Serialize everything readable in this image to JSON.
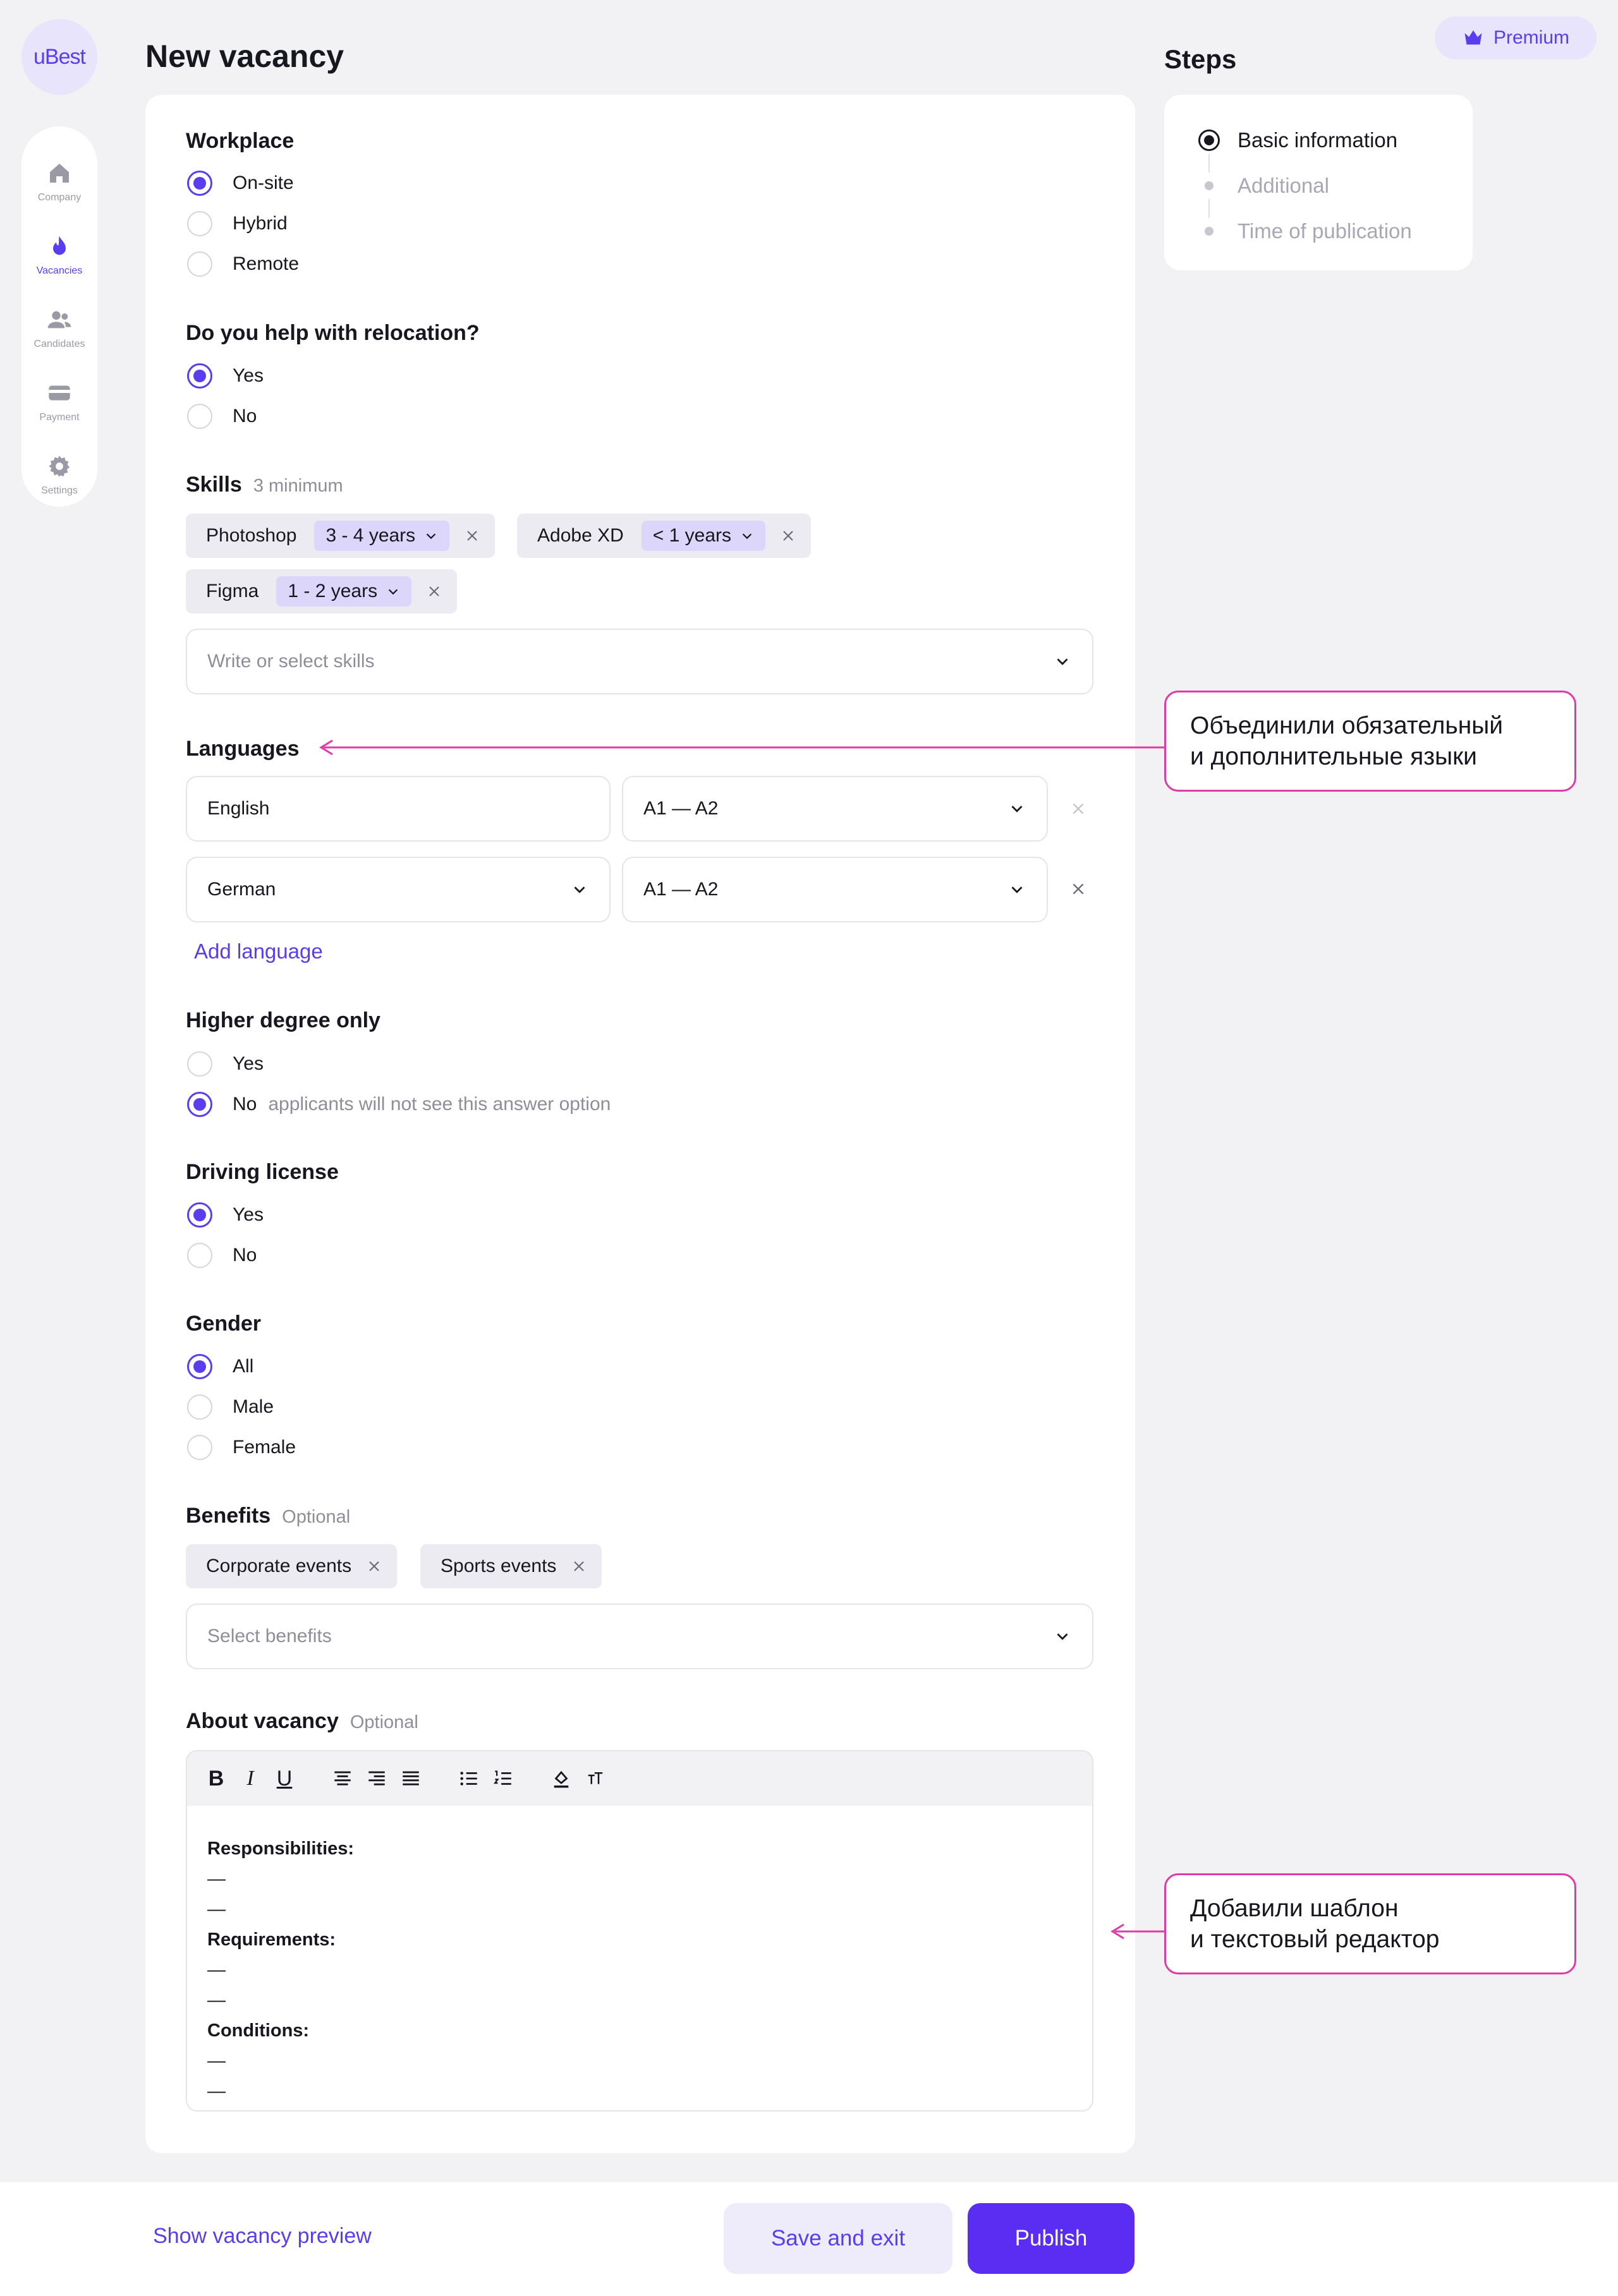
{
  "app": {
    "logo": "uBest",
    "premium_label": "Premium"
  },
  "nav": {
    "items": [
      {
        "label": "Company",
        "icon": "home-icon"
      },
      {
        "label": "Vacancies",
        "icon": "flame-icon"
      },
      {
        "label": "Candidates",
        "icon": "users-icon"
      },
      {
        "label": "Payment",
        "icon": "card-icon"
      },
      {
        "label": "Settings",
        "icon": "gear-icon"
      }
    ],
    "active": "Vacancies"
  },
  "page": {
    "title": "New vacancy"
  },
  "steps": {
    "title": "Steps",
    "items": [
      "Basic information",
      "Additional",
      "Time of publication"
    ],
    "current": "Basic information"
  },
  "form": {
    "workplace": {
      "label": "Workplace",
      "options": [
        "On-site",
        "Hybrid",
        "Remote"
      ],
      "selected": "On-site"
    },
    "relocation": {
      "label": "Do you help with relocation?",
      "options": [
        "Yes",
        "No"
      ],
      "selected": "Yes"
    },
    "skills": {
      "label": "Skills",
      "hint": "3 minimum",
      "chips": [
        {
          "name": "Photoshop",
          "years": "3 - 4 years"
        },
        {
          "name": "Adobe XD",
          "years": "< 1 years"
        },
        {
          "name": "Figma",
          "years": "1 - 2 years"
        }
      ],
      "placeholder": "Write or select skills"
    },
    "languages": {
      "label": "Languages",
      "rows": [
        {
          "language": "English",
          "level": "A1 — A2"
        },
        {
          "language": "German",
          "level": "A1 — A2"
        }
      ],
      "add_label": "Add language"
    },
    "higher_degree": {
      "label": "Higher degree only",
      "options": [
        "Yes",
        "No"
      ],
      "selected": "No",
      "no_hint": "applicants will not see this answer option"
    },
    "driving": {
      "label": "Driving license",
      "options": [
        "Yes",
        "No"
      ],
      "selected": "Yes"
    },
    "gender": {
      "label": "Gender",
      "options": [
        "All",
        "Male",
        "Female"
      ],
      "selected": "All"
    },
    "benefits": {
      "label": "Benefits",
      "hint": "Optional",
      "chips": [
        "Corporate events",
        "Sports events"
      ],
      "placeholder": "Select benefits"
    },
    "about": {
      "label": "About vacancy",
      "hint": "Optional",
      "toolbar": [
        "B",
        "I",
        "U"
      ],
      "body": {
        "responsibilities": "Responsibilities:",
        "requirements": "Requirements:",
        "conditions": "Conditions:",
        "dash": "—"
      }
    }
  },
  "callouts": {
    "languages_line1": "Объединили обязательный",
    "languages_line2": "и дополнительные языки",
    "editor_line1": "Добавили шаблон",
    "editor_line2": "и текстовый редактор"
  },
  "footer": {
    "preview_label": "Show vacancy preview",
    "save_label": "Save and exit",
    "publish_label": "Publish"
  },
  "colors": {
    "accent": "#5b3df0",
    "callout": "#e03aa8",
    "background": "#f2f2f5"
  }
}
